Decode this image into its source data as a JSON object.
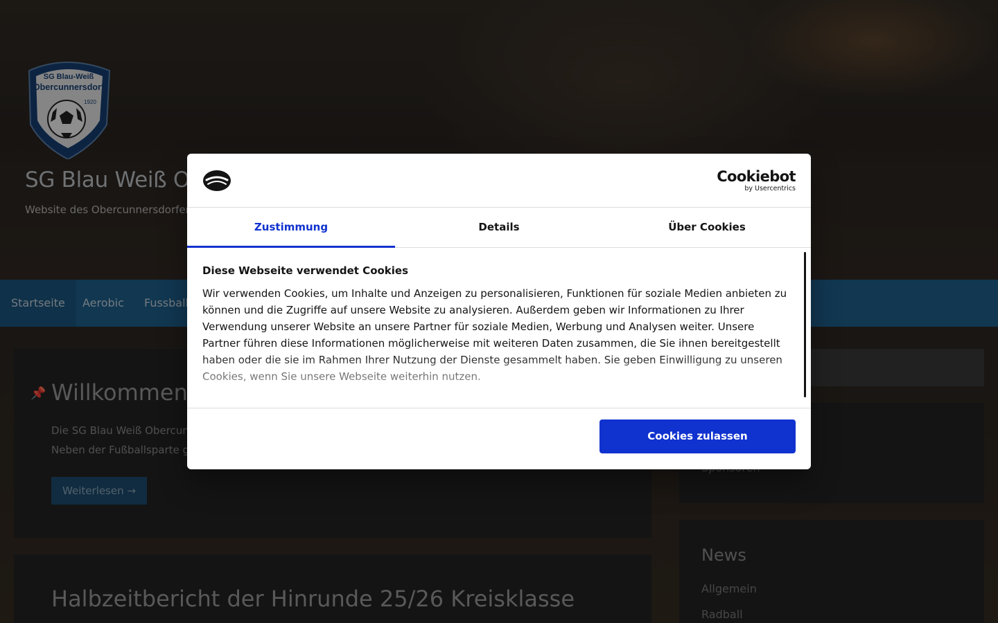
{
  "site": {
    "title": "SG Blau Weiß Obercunnersdorf",
    "tagline": "Website des Obercunnersdorfer Sportvereins",
    "logo": {
      "line1": "SG Blau-Weiß",
      "line2": "Obercunnersdorf",
      "year": "1920"
    }
  },
  "nav": {
    "items": [
      {
        "label": "Startseite"
      },
      {
        "label": "Aerobic"
      },
      {
        "label": "Fussball"
      }
    ]
  },
  "main": {
    "welcome": {
      "title": "Willkommen",
      "line1": "Die SG Blau Weiß Obercun",
      "line2": "Neben der Fußballsparte g",
      "button": "Weiterlesen →"
    },
    "post": {
      "title": "Halbzeitbericht der Hinrunde 25/26 Kreisklasse"
    }
  },
  "sidebar": {
    "links_box": {
      "item": "Sponsoren"
    },
    "news": {
      "heading": "News",
      "items": [
        {
          "label": "Allgemein"
        },
        {
          "label": "Radball"
        }
      ]
    }
  },
  "cookie_dialog": {
    "brand": "Cookiebot",
    "brand_sub": "by Usercentrics",
    "tabs": [
      {
        "label": "Zustimmung",
        "active": true
      },
      {
        "label": "Details",
        "active": false
      },
      {
        "label": "Über Cookies",
        "active": false
      }
    ],
    "heading": "Diese Webseite verwendet Cookies",
    "text": "Wir verwenden Cookies, um Inhalte und Anzeigen zu personalisieren, Funktionen für soziale Medien anbieten zu können und die Zugriffe auf unsere Website zu analysieren. Außerdem geben wir Informationen zu Ihrer Verwendung unserer Website an unsere Partner für soziale Medien, Werbung und Analysen weiter. Unsere Partner führen diese Informationen möglicherweise mit weiteren Daten zusammen, die Sie ihnen bereitgestellt haben oder die sie im Rahmen Ihrer Nutzung der Dienste gesammelt haben. Sie geben Einwilligung zu unseren Cookies, wenn Sie unsere Webseite weiterhin nutzen.",
    "allow_button": "Cookies zulassen"
  },
  "colors": {
    "accent": "#1032cf",
    "nav_bg": "#1e5f8c",
    "dialog_bg": "#ffffff",
    "text": "#141414"
  }
}
